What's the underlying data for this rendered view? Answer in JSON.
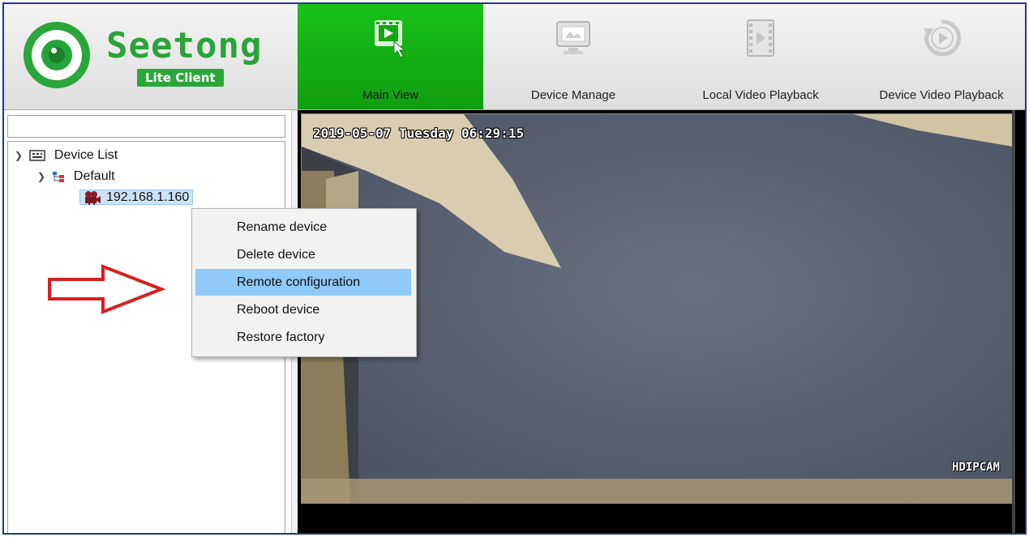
{
  "app": {
    "logo_name": "Seetong",
    "logo_sub": "Lite Client",
    "brand_color": "#29a33a"
  },
  "nav": [
    {
      "label": "Main View",
      "icon": "main-view-icon",
      "active": true
    },
    {
      "label": "Device Manage",
      "icon": "device-manage-icon",
      "active": false
    },
    {
      "label": "Local Video Playback",
      "icon": "local-playback-icon",
      "active": false
    },
    {
      "label": "Device Video Playback",
      "icon": "device-playback-icon",
      "active": false
    }
  ],
  "search": {
    "value": ""
  },
  "tree": {
    "root": "Device List",
    "group": "Default",
    "device": "192.168.1.160"
  },
  "video": {
    "timestamp": "2019-05-07 Tuesday 06:29:15",
    "camera_label": "HDIPCAM"
  },
  "context_menu": {
    "items": [
      {
        "label": "Rename device"
      },
      {
        "label": "Delete device"
      },
      {
        "label": "Remote configuration",
        "highlighted": true
      },
      {
        "label": "Reboot device"
      },
      {
        "label": "Restore factory"
      }
    ]
  },
  "annotation": {
    "arrow_color": "#d42020"
  }
}
